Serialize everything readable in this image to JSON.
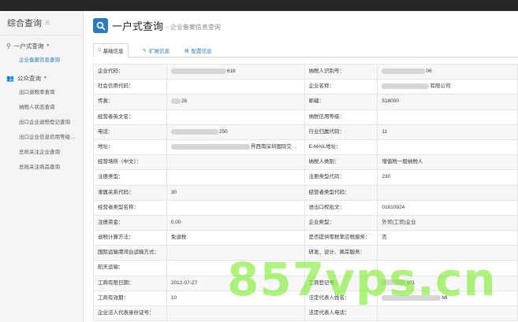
{
  "sidebar": {
    "title": "综合查询",
    "groups": [
      {
        "label": "一户式查询",
        "items": [
          "企业备案信息查询"
        ]
      },
      {
        "label": "公众查询",
        "items": [
          "出口退税率查询",
          "纳税人状态查询",
          "出口企业退税登记查询",
          "出口企业信息信用等级…",
          "总局关注企业查询",
          "总局关注商品查询"
        ]
      }
    ]
  },
  "header": {
    "title": "一户式查询",
    "subtitle": "- 企业备案信息查询"
  },
  "tabs": [
    {
      "label": "基础信息",
      "icon": "file-icon"
    },
    {
      "label": "扩展信息",
      "icon": "edit-icon"
    },
    {
      "label": "配置信息",
      "icon": "doc-icon"
    }
  ],
  "table": [
    [
      "企业代码：",
      "618",
      "纳税人识别号：",
      "06"
    ],
    [
      "社会信用代码：",
      "",
      "企业名称：",
      "有限公司"
    ],
    [
      "传真：",
      "26",
      "邮编：",
      "518000"
    ],
    [
      "经营者英文名：",
      "",
      "纳税信用等级：",
      ""
    ],
    [
      "电话：",
      "250",
      "行业归属代码：",
      "11"
    ],
    [
      "地址：",
      "界西南深圳国际交…",
      "E-MAIL地址：",
      ""
    ],
    [
      "经营场所（中文）：",
      "",
      "纳税人类别：",
      "增值税一般纳税人"
    ],
    [
      "注册类型：",
      "",
      "注册类型代码：",
      "230"
    ],
    [
      "隶属关系代码：",
      "30",
      "经营者类型代码：",
      ""
    ],
    [
      "经营者类型名称：",
      "",
      "进出口权批文：",
      "01610924"
    ],
    [
      "注册资金：",
      "0.00",
      "企业类型：",
      "外贸(工贸)企业"
    ],
    [
      "退税计算方法：",
      "免退税",
      "是否提供零税率应税服务：",
      "否"
    ],
    [
      "国际运输港湾台运输方式：",
      "",
      "研发、设计、离岸服务：",
      ""
    ],
    [
      "航天运输：",
      "",
      "",
      ""
    ],
    [
      "工商有限日期：",
      "2012-07-27",
      "工商登记号：",
      "101"
    ],
    [
      "工商有效期：",
      "10",
      "法定代表人姓名：",
      "MI"
    ],
    [
      "企业法人代表身份证号：",
      "",
      "法定代表人电话：",
      ""
    ]
  ],
  "watermark": "857vps.cn"
}
